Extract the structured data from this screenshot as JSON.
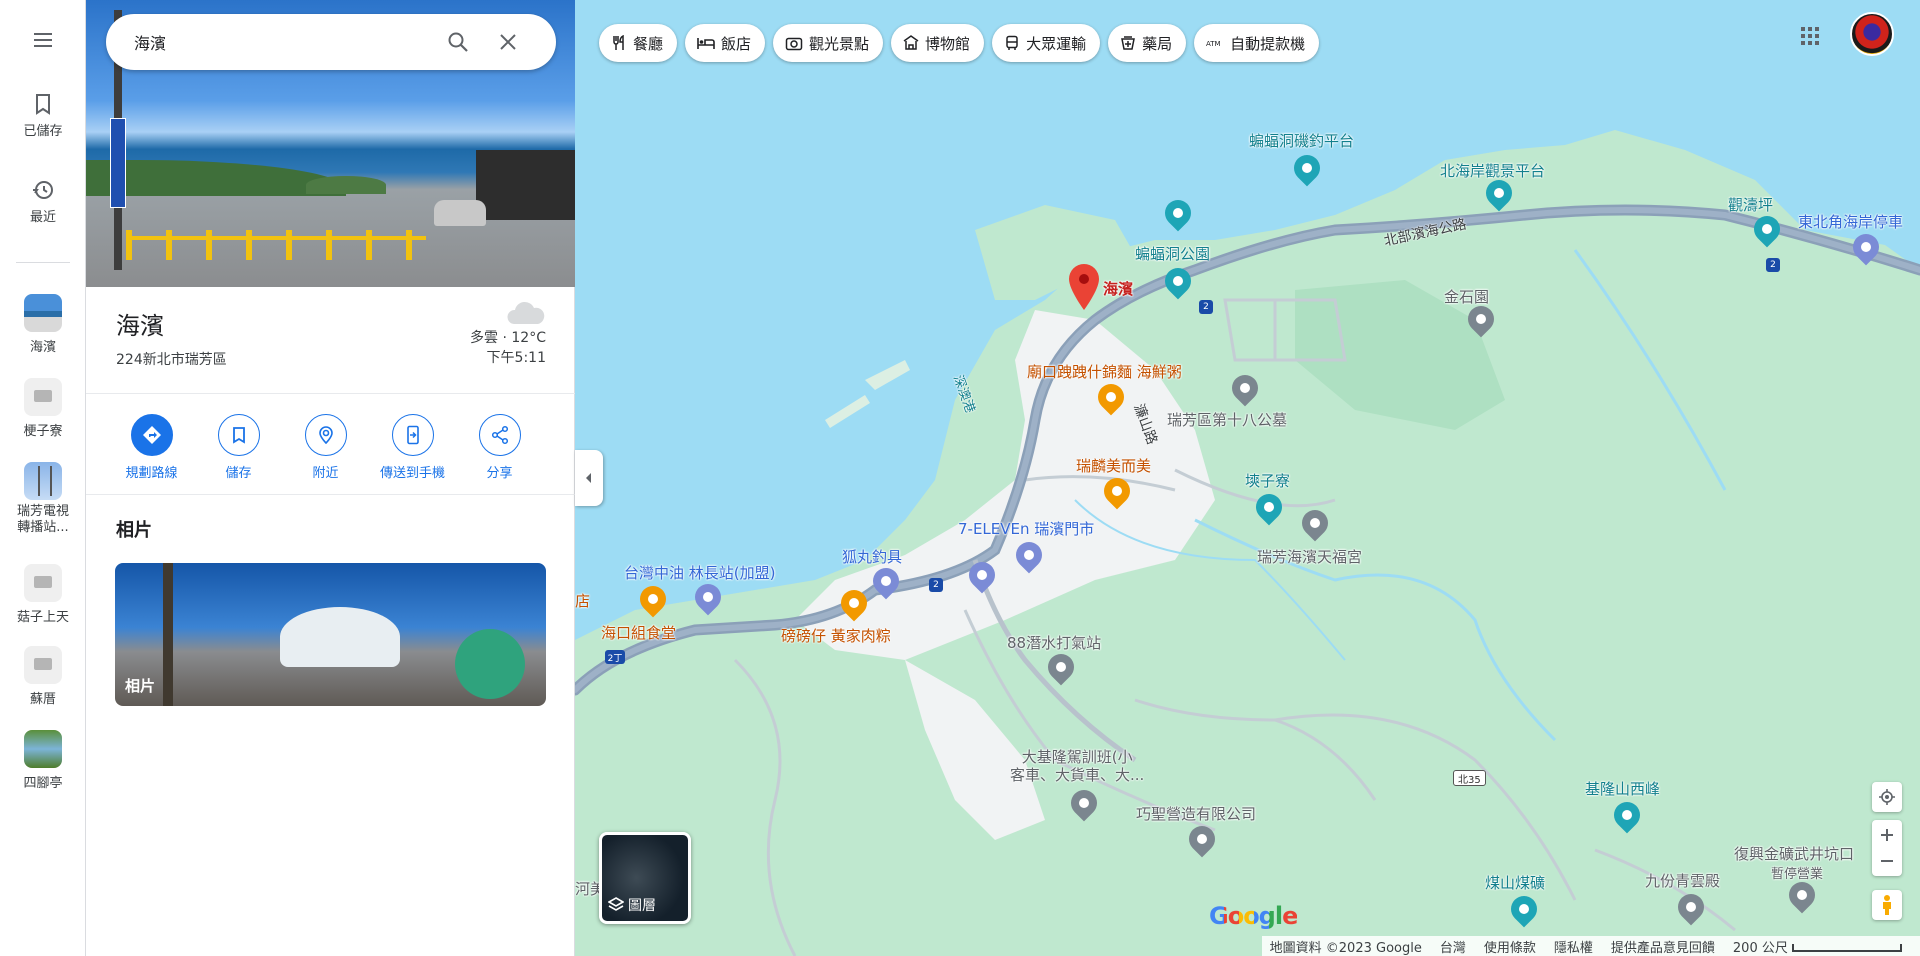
{
  "rail": {
    "saved_label": "已儲存",
    "recent_label": "最近",
    "recents": [
      {
        "label": "海濱",
        "thumb": "photo-seaside"
      },
      {
        "label": "梗子寮",
        "thumb": "placeholder-building"
      },
      {
        "label": "瑞芳電視\n轉播站...",
        "thumb": "photo-tower"
      },
      {
        "label": "菇子上天",
        "thumb": "placeholder-building"
      },
      {
        "label": "蘇厝",
        "thumb": "placeholder-building"
      },
      {
        "label": "四腳亭",
        "thumb": "photo-river"
      }
    ]
  },
  "search": {
    "value": "海濱"
  },
  "place": {
    "title": "海濱",
    "address": "224新北市瑞芳區",
    "weather": "多雲 · 12°C",
    "time": "下午5:11"
  },
  "actions": [
    {
      "label": "規劃路線",
      "icon": "directions-icon"
    },
    {
      "label": "儲存",
      "icon": "bookmark-icon"
    },
    {
      "label": "附近",
      "icon": "nearby-icon"
    },
    {
      "label": "傳送到手機",
      "icon": "send-to-phone-icon"
    },
    {
      "label": "分享",
      "icon": "share-icon"
    }
  ],
  "photos": {
    "heading": "相片",
    "card_label": "相片"
  },
  "chips": [
    {
      "label": "餐廳",
      "icon": "fork-knife-icon"
    },
    {
      "label": "飯店",
      "icon": "bed-icon"
    },
    {
      "label": "觀光景點",
      "icon": "camera-icon"
    },
    {
      "label": "博物館",
      "icon": "museum-icon"
    },
    {
      "label": "大眾運輸",
      "icon": "bus-icon"
    },
    {
      "label": "藥局",
      "icon": "pharmacy-icon"
    },
    {
      "label": "自動提款機",
      "icon": "atm-icon"
    }
  ],
  "map": {
    "labels": {
      "bat_fishing": "蝙蝠洞磯釣平台",
      "north_coast": "北海岸觀景平台",
      "guantaoping": "觀濤坪",
      "northeast_parking": "東北角海岸停車",
      "bat_park": "蝙蝠洞公園",
      "north_coast_road": "北部濱海公路",
      "selected": "海濱",
      "jinshi": "金石園",
      "temple_rest": "廟口跩跩什錦麵 海鮮粥",
      "cemetery": "瑞芳區第十八公墓",
      "lin_road": "濂山路",
      "ruilin": "瑞麟美而美",
      "shenao_port": "深澳港",
      "lizi": "塽子寮",
      "seven": "7-ELEVEn 瑞濱門市",
      "tianfu": "瑞芳海濱天福宮",
      "cpc": "台灣中油 林長站(加盟)",
      "fox": "狐丸釣具",
      "store_edge": "店",
      "haikou": "海口組食堂",
      "bangbang": "磅磅仔 黃家肉粽",
      "diving": "88潛水打氣站",
      "driving": "大基隆駕訓班(小\n客車、大貨車、大...",
      "qiaosheng": "巧聖營造有限公司",
      "keelung_peak": "基隆山西峰",
      "gold_mine": "復興金礦武井坑口",
      "temp_closed": "暫停營業",
      "jiufen": "九份青雲殿",
      "coal": "煤山煤礦",
      "he_edge": "河美"
    },
    "shields": {
      "route2": "2",
      "route2b": "2",
      "route2c": "2",
      "route2d": "2",
      "route2ding": "2丁",
      "bei35": "北35"
    },
    "layers_label": "圖層",
    "google": "Google"
  },
  "footer": {
    "copyright": "地圖資料 ©2023 Google",
    "region": "台灣",
    "terms": "使用條款",
    "privacy": "隱私權",
    "feedback": "提供產品意見回饋",
    "scale": "200 公尺"
  },
  "colors": {
    "water": "#9ddcf4",
    "land": "#bfe8cf",
    "urban": "#f1f3f4",
    "road": "#8ba0b8",
    "accent": "#1a73e8"
  }
}
